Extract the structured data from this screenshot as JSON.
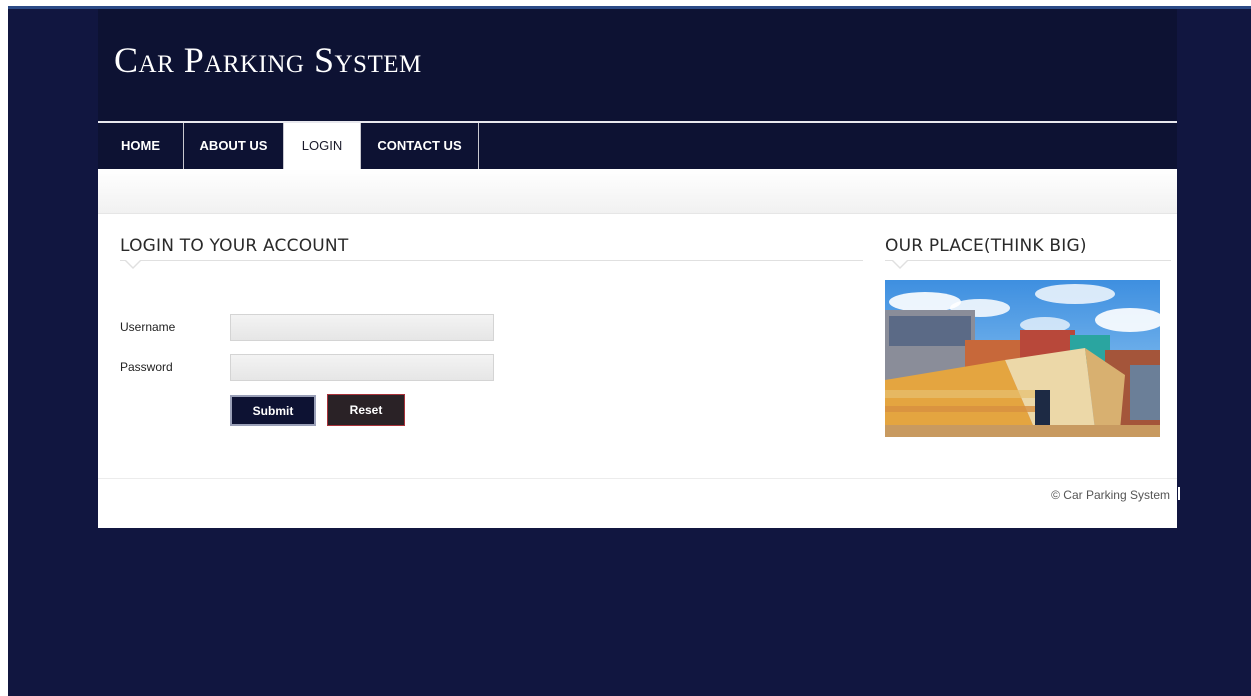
{
  "site": {
    "title": "Car Parking System"
  },
  "nav": {
    "items": [
      {
        "label": "HOME",
        "active": false
      },
      {
        "label": "ABOUT US",
        "active": false
      },
      {
        "label": "LOGIN",
        "active": true
      },
      {
        "label": "CONTACT US",
        "active": false
      }
    ]
  },
  "login": {
    "title": "LOGIN TO YOUR ACCOUNT",
    "username_label": "Username",
    "username_value": "",
    "password_label": "Password",
    "password_value": "",
    "submit_label": "Submit",
    "reset_label": "Reset"
  },
  "sidebar": {
    "title": "OUR PLACE(THINK BIG)"
  },
  "footer": {
    "copyright": "© Car Parking System"
  },
  "colors": {
    "background": "#111640",
    "header": "#0d1233",
    "content": "#ffffff",
    "reset_border": "#a8323a"
  },
  "icons": {
    "photo": "building-photo"
  }
}
